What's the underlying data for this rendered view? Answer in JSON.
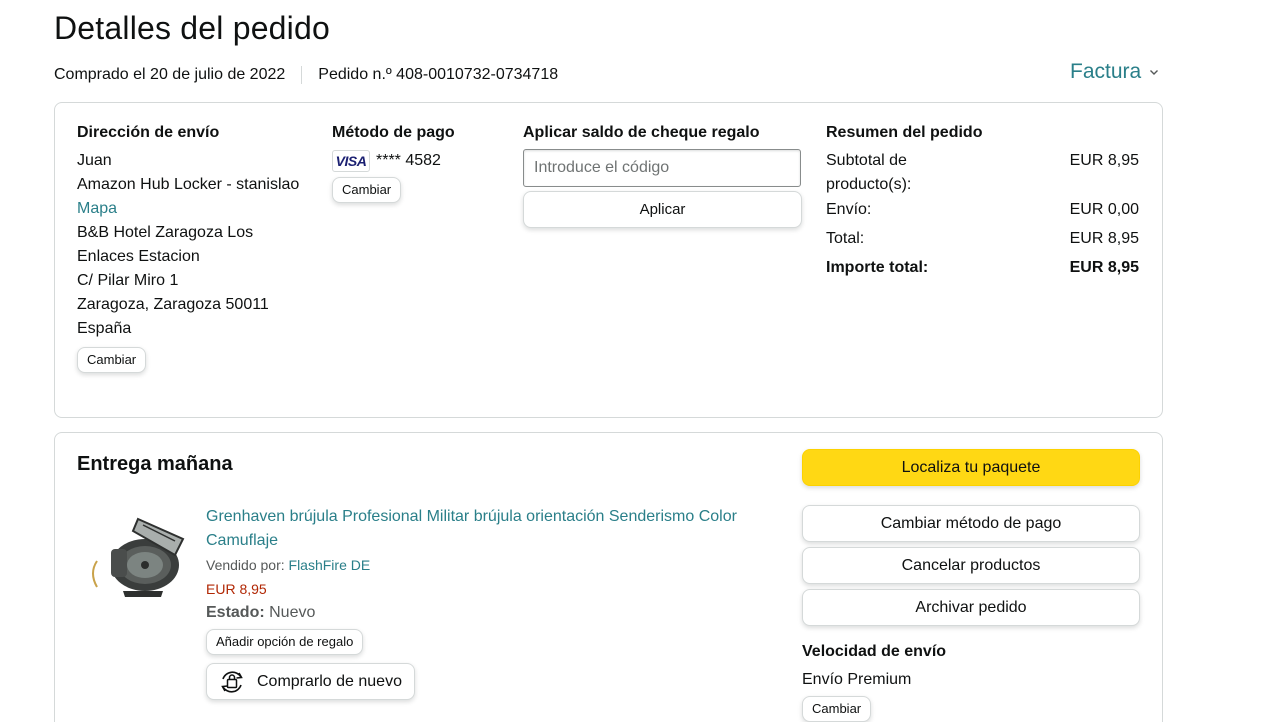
{
  "page": {
    "title": "Detalles del pedido"
  },
  "order_meta": {
    "purchased": "Comprado el 20 de julio de 2022",
    "order_number": "Pedido n.º 408-0010732-0734718",
    "invoice_label": "Factura"
  },
  "shipping_address": {
    "heading": "Dirección de envío",
    "name": "Juan",
    "locker": "Amazon Hub Locker - stanislao",
    "map_link": "Mapa",
    "line1": "B&B Hotel Zaragoza Los",
    "line2": "Enlaces Estacion",
    "line3": "C/ Pilar Miro 1",
    "line4": "Zaragoza, Zaragoza 50011",
    "country": "España",
    "change_label": "Cambiar"
  },
  "payment": {
    "heading": "Método de pago",
    "card_brand": "VISA",
    "card_masked": "**** 4582",
    "change_label": "Cambiar"
  },
  "gift_card": {
    "heading": "Aplicar saldo de cheque regalo",
    "placeholder": "Introduce el código",
    "apply_label": "Aplicar"
  },
  "summary": {
    "heading": "Resumen del pedido",
    "rows": [
      {
        "label": "Subtotal de producto(s):",
        "value": "EUR 8,95"
      },
      {
        "label": "Envío:",
        "value": "EUR 0,00"
      },
      {
        "label": "Total:",
        "value": "EUR 8,95"
      }
    ],
    "grand_total_label": "Importe total:",
    "grand_total_value": "EUR 8,95"
  },
  "delivery": {
    "title": "Entrega mañana",
    "product": {
      "title": "Grenhaven brújula Profesional Militar brújula orientación Senderismo Color Camuflaje",
      "sold_by_label": "Vendido por:",
      "seller": "FlashFire DE",
      "price": "EUR 8,95",
      "status_label": "Estado:",
      "status_value": "Nuevo",
      "gift_option_label": "Añadir opción de regalo",
      "buy_again_label": "Comprarlo de nuevo"
    },
    "actions": {
      "track": "Localiza tu paquete",
      "change_payment": "Cambiar método de pago",
      "cancel": "Cancelar productos",
      "archive": "Archivar pedido"
    },
    "shipping_speed": {
      "heading": "Velocidad de envío",
      "value": "Envío Premium",
      "change_label": "Cambiar"
    }
  },
  "colors": {
    "link": "#2a7f89",
    "price": "#b12704",
    "primary_button": "#ffd814",
    "border": "#d5d9d9"
  },
  "icons": [
    "chevron-down-icon",
    "visa-card-icon",
    "buy-again-icon",
    "product-image"
  ]
}
